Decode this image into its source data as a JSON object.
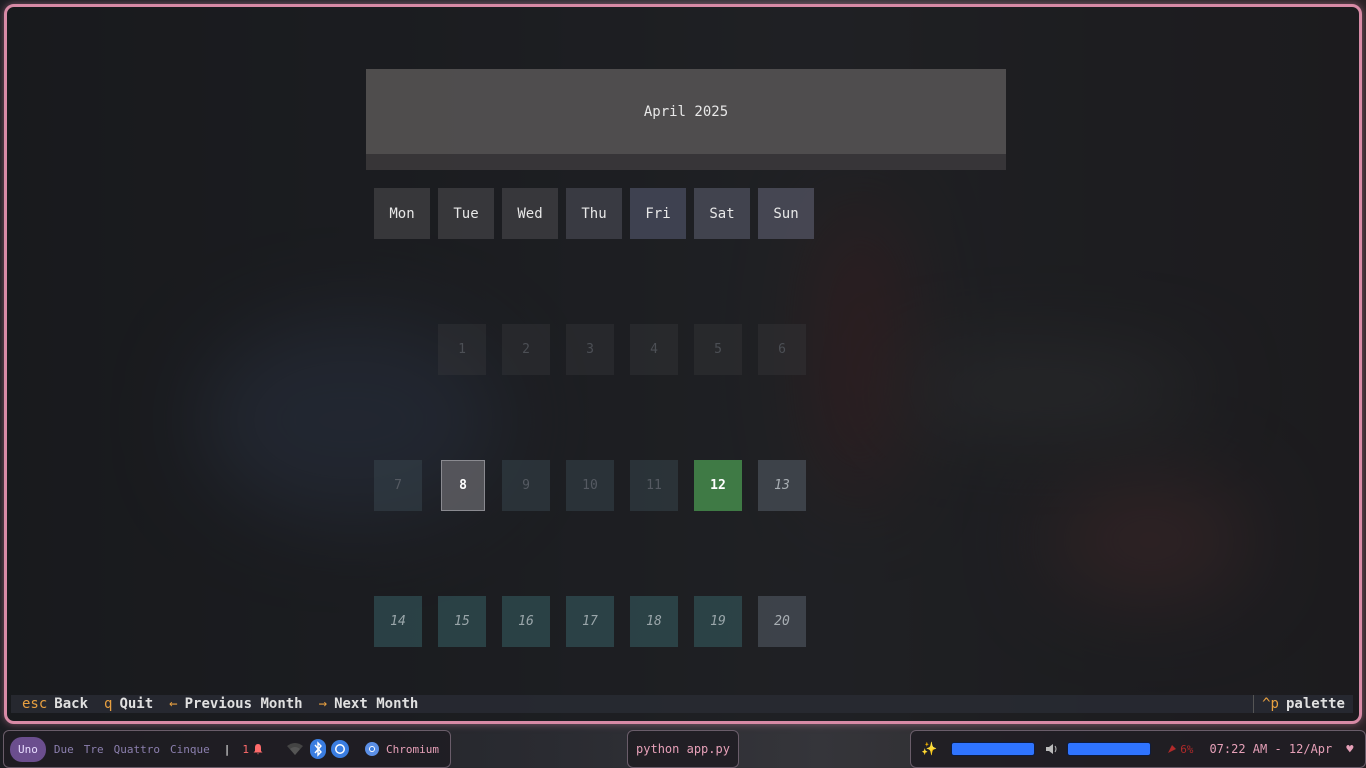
{
  "calendar": {
    "title": "April 2025",
    "weekdays": [
      "Mon",
      "Tue",
      "Wed",
      "Thu",
      "Fri",
      "Sat",
      "Sun"
    ],
    "weeks": [
      [
        "",
        "1",
        "2",
        "3",
        "4",
        "5",
        "6"
      ],
      [
        "7",
        "8",
        "9",
        "10",
        "11",
        "12",
        "13"
      ],
      [
        "14",
        "15",
        "16",
        "17",
        "18",
        "19",
        "20"
      ]
    ],
    "today": "12",
    "selected": "8"
  },
  "footer": {
    "bindings": [
      {
        "key": "esc",
        "label": "Back"
      },
      {
        "key": "q",
        "label": "Quit"
      },
      {
        "key": "←",
        "label": "Previous Month"
      },
      {
        "key": "→",
        "label": "Next Month"
      }
    ],
    "palette_key": "^p",
    "palette_label": "palette"
  },
  "taskbar": {
    "workspaces": [
      "Uno",
      "Due",
      "Tre",
      "Quattro",
      "Cinque"
    ],
    "active_workspace": "Uno",
    "separator": "|",
    "notification_count": "1",
    "app_label": "Chromium",
    "window_title": "python app.py",
    "battery": "6%",
    "clock": "07:22 AM - 12/Apr",
    "brightness_level": 1.0,
    "volume_level": 1.0
  },
  "colors": {
    "frame_accent": "#d88aa6",
    "today_bg": "#3f7a45",
    "meter": "#2f74ff",
    "key_accent": "#e8a040"
  }
}
